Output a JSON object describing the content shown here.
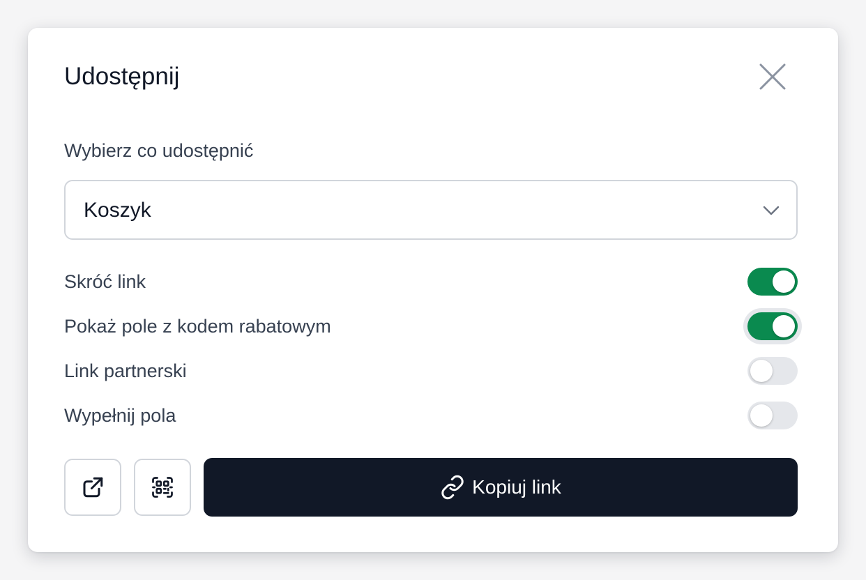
{
  "dialog": {
    "title": "Udostępnij",
    "close_icon": "close-icon"
  },
  "share_select": {
    "label": "Wybierz co udostępnić",
    "value": "Koszyk",
    "icon": "chevron-down-icon"
  },
  "options": [
    {
      "label": "Skróć link",
      "enabled": true
    },
    {
      "label": "Pokaż pole z kodem rabatowym",
      "enabled": true
    },
    {
      "label": "Link partnerski",
      "enabled": false
    },
    {
      "label": "Wypełnij pola",
      "enabled": false
    }
  ],
  "actions": {
    "open_icon": "external-link-icon",
    "qr_icon": "qr-code-scan-icon",
    "copy_label": "Kopiuj link",
    "copy_icon": "link-icon"
  },
  "colors": {
    "toggle_on": "#0a8a4f",
    "toggle_off": "#e5e7eb",
    "primary_button": "#111827"
  }
}
